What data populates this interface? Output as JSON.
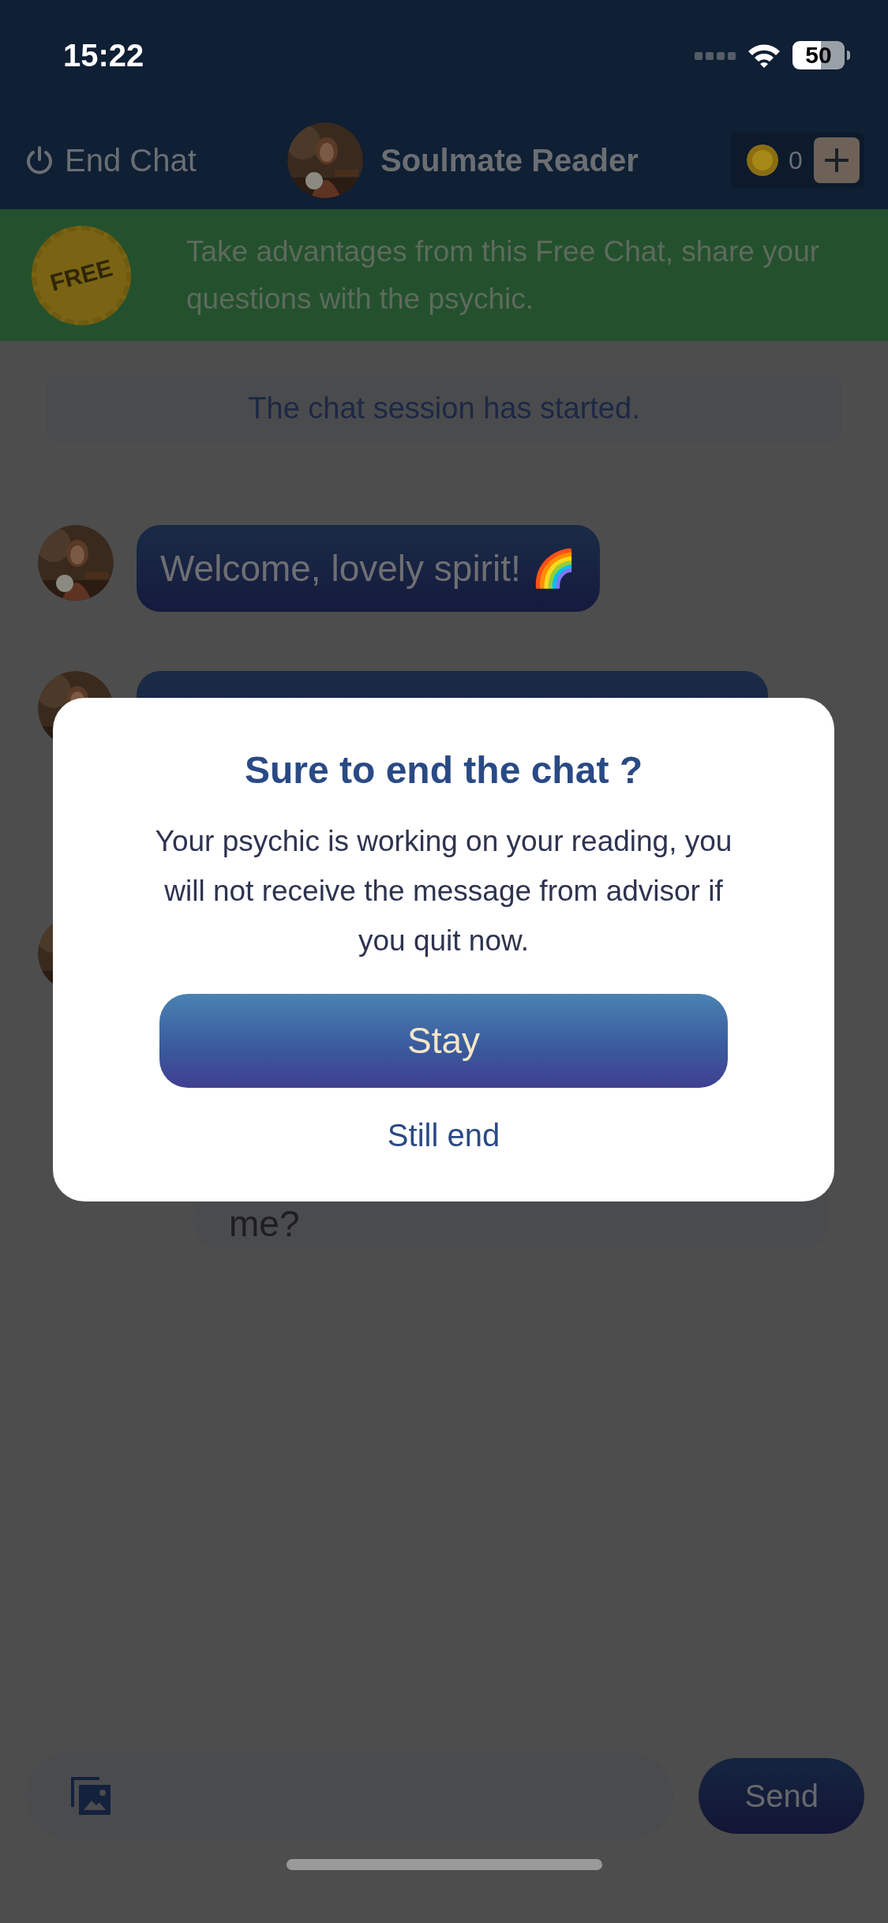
{
  "status_bar": {
    "time": "15:22",
    "battery": "50"
  },
  "header": {
    "end_chat": "End Chat",
    "advisor_name": "Soulmate Reader",
    "coins": "0"
  },
  "banner": {
    "badge": "FREE",
    "text": "Take advantages from this Free Chat, share your questions with the psychic."
  },
  "system_message": "The chat session has started.",
  "messages": [
    {
      "kind": "advisor",
      "text": "Welcome, lovely spirit! 🌈"
    },
    {
      "kind": "advisor"
    },
    {
      "kind": "avatar_only"
    },
    {
      "kind": "user",
      "text": "me?"
    }
  ],
  "dialog": {
    "title": "Sure to end the chat ?",
    "body": "Your psychic is working on your reading, you will not receive the message from advisor if you quit now.",
    "primary": "Stay",
    "secondary": "Still end"
  },
  "composer": {
    "send": "Send"
  }
}
